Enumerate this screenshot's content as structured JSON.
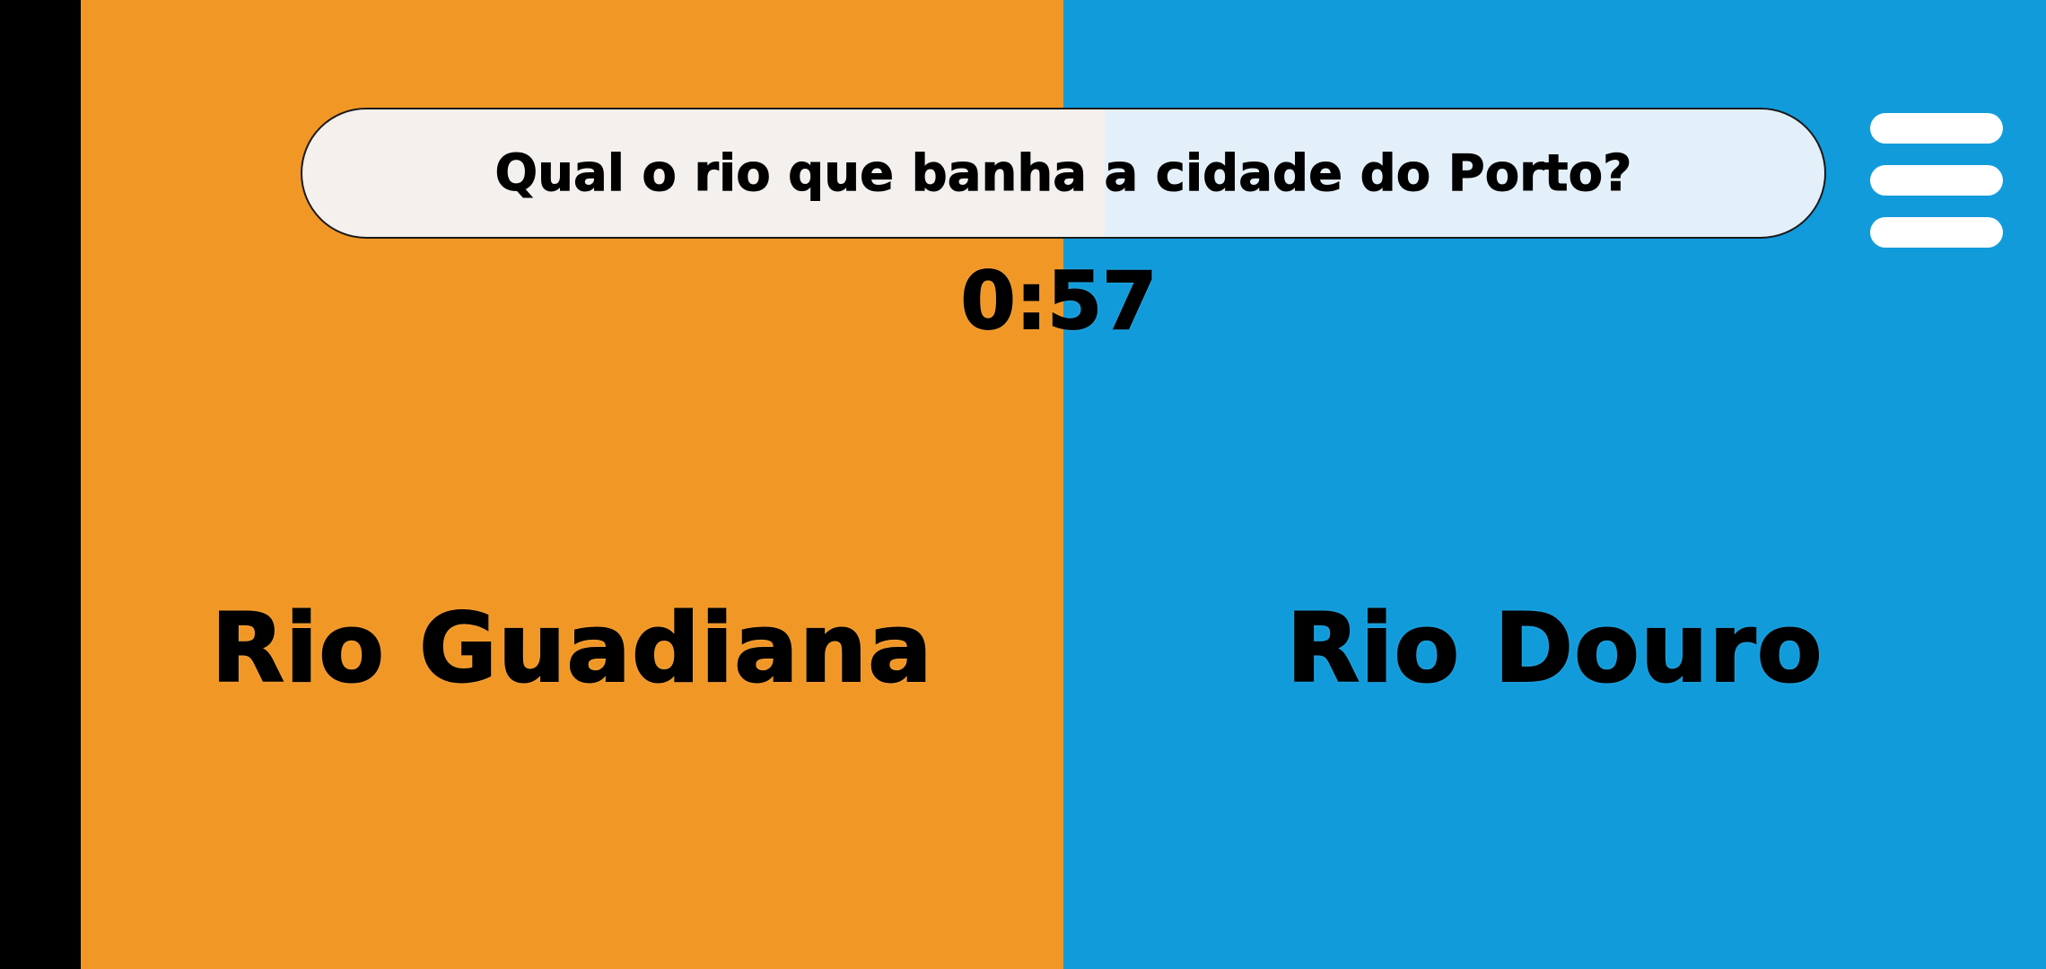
{
  "question": {
    "text": "Qual o rio que banha a cidade do Porto?"
  },
  "timer": {
    "text": "0:57"
  },
  "answers": [
    {
      "label": "Rio Guadiana",
      "color": "#f19726"
    },
    {
      "label": "Rio Douro",
      "color": "#119bdb"
    }
  ],
  "menu": {
    "icon": "hamburger-menu-icon"
  }
}
